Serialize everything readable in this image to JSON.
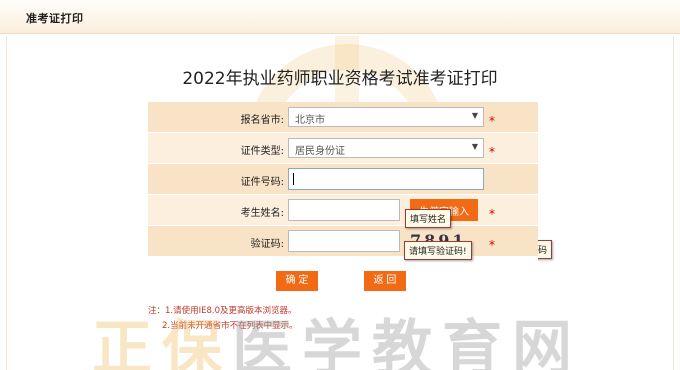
{
  "window": {
    "title": "准考证打印"
  },
  "page": {
    "title": "2022年执业药师职业资格考试准考证打印"
  },
  "watermark": {
    "brand1": "正保",
    "brand2": "医学教育网"
  },
  "form": {
    "city": {
      "label": "报名省市:",
      "value": "北京市"
    },
    "id_type": {
      "label": "证件类型:",
      "value": "居民身份证"
    },
    "id_number": {
      "label": "证件号码:",
      "value": "",
      "tip": "填写证件号码"
    },
    "name": {
      "label": "考生姓名:",
      "value": "",
      "tip": "填写姓名",
      "button_label": "生僻字输入"
    },
    "captcha": {
      "label": "验证码:",
      "value": "",
      "tip": "请填写验证码!",
      "image_text": "7891"
    },
    "required_mark": "*"
  },
  "actions": {
    "confirm_label": "确 定",
    "back_label": "返 回"
  },
  "notes": [
    "注：1.请使用IE8.0及更高版本浏览器。",
    "2.当前未开通省市不在列表中显示。"
  ],
  "colors": {
    "accent": "#f26a14",
    "row_dark": "#f9e3c6",
    "row_light": "#fcefdd",
    "required": "#d30000"
  }
}
